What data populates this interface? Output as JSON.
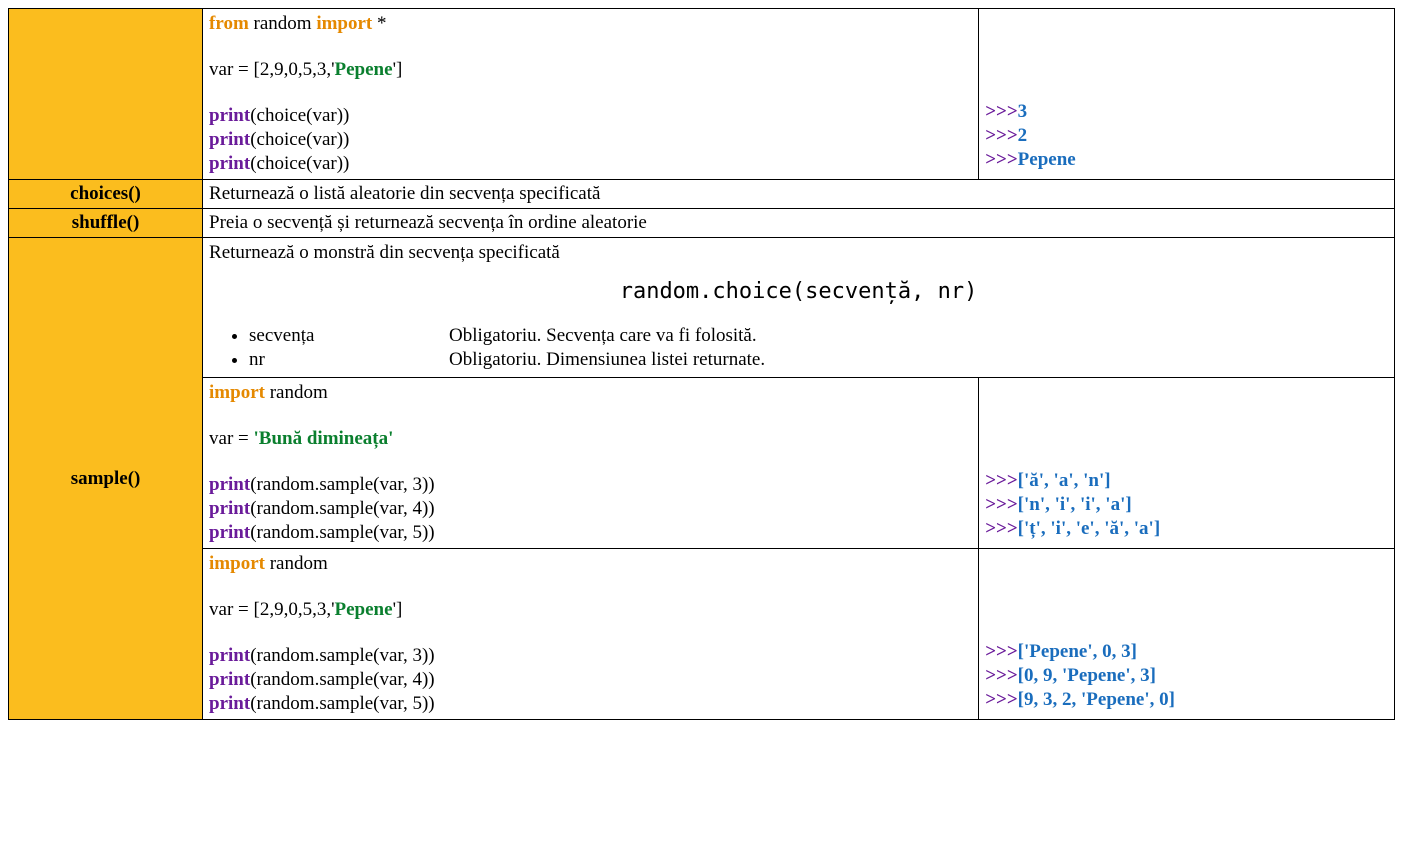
{
  "row1": {
    "code": {
      "l1_from": "from",
      "l1_mid": " random ",
      "l1_import": "import",
      "l1_end": " *",
      "l2_a": "var = [2,9,0,5,3,'",
      "l2_str": "Pepene",
      "l2_b": "']",
      "l3_p": "print",
      "l3_r": "(choice(var))",
      "l4_p": "print",
      "l4_r": "(choice(var))",
      "l5_p": "print",
      "l5_r": "(choice(var))"
    },
    "out": {
      "p": ">>>",
      "v1": "3",
      "v2": "2",
      "v3": "Pepene"
    }
  },
  "row2": {
    "name": "choices()",
    "desc": "Returnează o listă aleatorie din secvența specificată"
  },
  "row3": {
    "name": "shuffle()",
    "desc": "Preia o secvență și returnează secvența în ordine aleatorie"
  },
  "row4": {
    "name": "sample()",
    "desc": {
      "line1": "Returnează o monstră din secvența specificată",
      "sig": "random.choice(secvență, nr)",
      "p1k": "secvența",
      "p1v": "Obligatoriu. Secvența care va fi folosită.",
      "p2k": "nr",
      "p2v": "Obligatoriu. Dimensiunea listei returnate."
    },
    "codeA": {
      "l1_import": "import",
      "l1_rest": " random",
      "l2_a": "var = ",
      "l2_str": "'Bună dimineața'",
      "l3_p": "print",
      "l3_r": "(random.sample(var, 3))",
      "l4_p": "print",
      "l4_r": "(random.sample(var, 4))",
      "l5_p": "print",
      "l5_r": "(random.sample(var, 5))"
    },
    "outA": {
      "p": ">>>",
      "v1": "['ă', 'a', 'n']",
      "v2": "['n', 'i', 'i', 'a']",
      "v3": "['ț', 'i', 'e', 'ă', 'a']"
    },
    "codeB": {
      "l1_import": "import",
      "l1_rest": " random",
      "l2_a": "var = [2,9,0,5,3,'",
      "l2_str": "Pepene",
      "l2_b": "']",
      "l3_p": "print",
      "l3_r": "(random.sample(var, 3))",
      "l4_p": "print",
      "l4_r": "(random.sample(var, 4))",
      "l5_p": "print",
      "l5_r": "(random.sample(var, 5))"
    },
    "outB": {
      "p": ">>>",
      "v1": "['Pepene', 0, 3]",
      "v2": "[0, 9, 'Pepene', 3]",
      "v3": "[9, 3, 2, 'Pepene', 0]"
    }
  }
}
